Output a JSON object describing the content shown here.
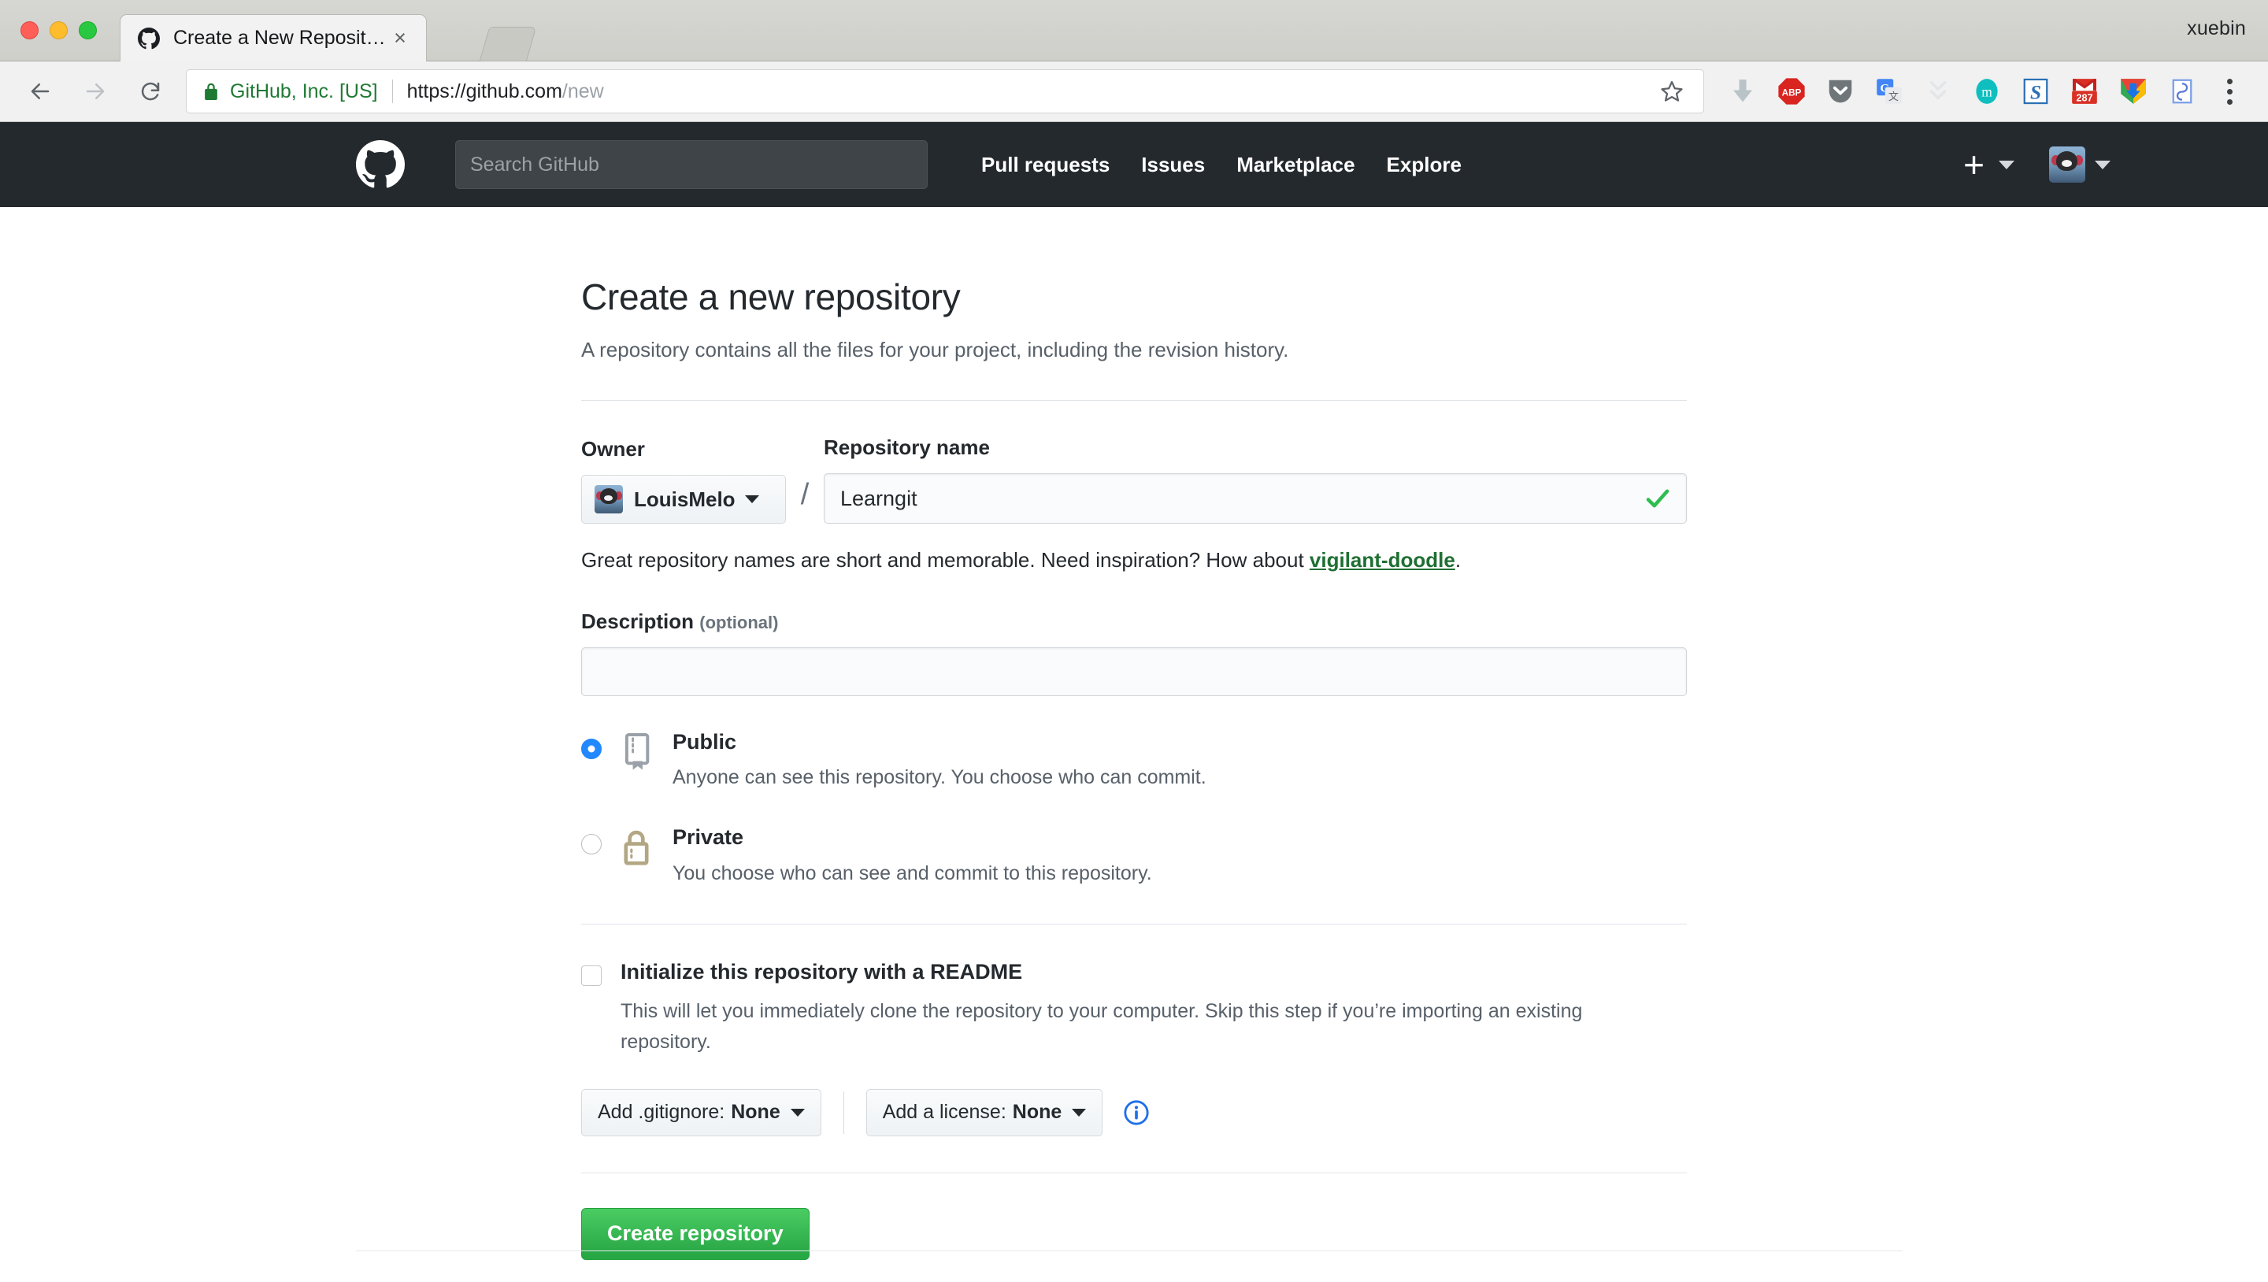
{
  "os": {
    "window_user": "xuebin"
  },
  "browser": {
    "tab": {
      "title": "Create a New Repository",
      "favicon": "github-icon",
      "close": "×"
    },
    "new_tab_button": "new-tab-button",
    "nav": {
      "back": "back-arrow-icon",
      "forward": "forward-arrow-icon",
      "reload": "reload-icon"
    },
    "omnibox": {
      "lock": "lock-icon",
      "secure_label": "GitHub, Inc. [US]",
      "url_host": "https://github.com",
      "url_path": "/new",
      "bookmark": "star-icon"
    },
    "extensions": [
      "download-arrow-icon",
      "adblock-plus-icon",
      "pocket-icon",
      "google-translate-icon",
      "chevron-extension-icon",
      "mendeley-icon",
      "s-extension-icon",
      "gmail-icon",
      "chrome-download-icon",
      "blue-doc-icon"
    ],
    "gmail_badge": "287",
    "menu": "kebab-menu-icon"
  },
  "github_header": {
    "logo": "octocat-logo",
    "search_placeholder": "Search GitHub",
    "search_value": "",
    "nav": [
      {
        "label": "Pull requests"
      },
      {
        "label": "Issues"
      },
      {
        "label": "Marketplace"
      },
      {
        "label": "Explore"
      }
    ],
    "create_new": "+",
    "avatar": "user-avatar"
  },
  "main": {
    "title": "Create a new repository",
    "subtitle": "A repository contains all the files for your project, including the revision history.",
    "owner": {
      "label": "Owner",
      "value": "LouisMelo",
      "separator": "/"
    },
    "repository": {
      "label": "Repository name",
      "value": "Learngit",
      "valid_icon": "green-check-icon"
    },
    "hint": {
      "text": "Great repository names are short and memorable. Need inspiration? How about ",
      "suggestion": "vigilant-doodle",
      "suffix": "."
    },
    "description": {
      "label": "Description",
      "optional": "(optional)",
      "value": "",
      "placeholder": ""
    },
    "visibility": [
      {
        "name": "Public",
        "desc": "Anyone can see this repository. You choose who can commit.",
        "selected": true,
        "icon": "repo-book-icon"
      },
      {
        "name": "Private",
        "desc": "You choose who can see and commit to this repository.",
        "selected": false,
        "icon": "lock-icon"
      }
    ],
    "readme": {
      "label": "Initialize this repository with a README",
      "desc": "This will let you immediately clone the repository to your computer. Skip this step if you’re importing an existing repository.",
      "checked": false
    },
    "gitignore_button": {
      "prefix": "Add .gitignore:",
      "value": "None"
    },
    "license_button": {
      "prefix": "Add a license:",
      "value": "None"
    },
    "info_icon": "info-circle-icon",
    "submit": "Create repository"
  },
  "colors": {
    "header_bg": "#24292e",
    "accent_green": "#28a745",
    "link_green": "#1f6f33",
    "radio_blue": "#2188ff",
    "private_gold": "#b3a683",
    "secure_green": "#1f7a33"
  }
}
